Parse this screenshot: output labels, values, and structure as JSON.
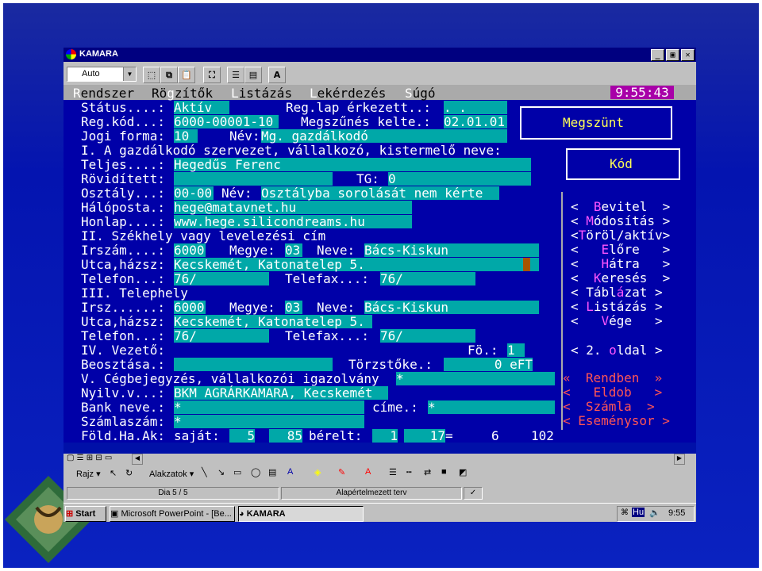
{
  "window": {
    "title": "KAMARA",
    "minimize": "_",
    "maximize": "▣",
    "close": "✕"
  },
  "toolbar": {
    "font_combo": "Auto",
    "font_button": "A"
  },
  "menu": {
    "items": [
      {
        "hotkey": "R",
        "rest": "endszer"
      },
      {
        "pre": "Rö",
        "hotkey": "g",
        "rest": "zítők"
      },
      {
        "hotkey": "L",
        "rest": "istázás"
      },
      {
        "hotkey": "L",
        "rest": "ekérdezés"
      },
      {
        "hotkey": "S",
        "rest": "úgó"
      }
    ],
    "clock": "9:55:43"
  },
  "form": {
    "status_label": "Státus....:",
    "status_value": "Aktív",
    "reg_lap_label": "Reg.lap érkezett..:",
    "reg_lap_value": ". .",
    "reg_kod_label": "Reg.kód...:",
    "reg_kod_value": "6000-00001-10",
    "megszunes_label": "Megszűnés kelte.:",
    "megszunes_value": "02.01.01",
    "jogi_label": "Jogi forma:",
    "jogi_value": "10",
    "jogi_nev_label": "Név:",
    "jogi_nev_value": "Mg. gazdálkodó",
    "section1": "I. A gazdálkodó szervezet, vállalkozó, kistermelő neve:",
    "teljes_label": "Teljes....:",
    "teljes_value": "Hegedűs Ferenc",
    "rovid_label": "Rövidített:",
    "tg_label": "TG:",
    "tg_value": "0",
    "osztaly_label": "Osztály...:",
    "osztaly_value": "00-00",
    "osztaly_nev_label": "Név:",
    "osztaly_nev_value": "Osztályba sorolását nem kérte",
    "haloposta_label": "Hálóposta.:",
    "haloposta_value": "hege@matavnet.hu",
    "honlap_label": "Honlap....:",
    "honlap_value": "www.hege.silicondreams.hu",
    "section2": "II. Székhely vagy levelezési cím",
    "irszam_label": "Irszám....:",
    "irszam_value": "6000",
    "megye_label": "Megye:",
    "megye_value": "03",
    "neve_label": "Neve:",
    "neve_value": "Bács-Kiskun",
    "utca_label": "Utca,házsz:",
    "utca_value": "Kecskemét, Katonatelep 5.",
    "telefon_label": "Telefon...:",
    "telefon_value": "76/",
    "telefax_label": "Telefax...:",
    "telefax_value": "76/",
    "section3": "III. Telephely",
    "irsz3_label": "Irsz......:",
    "irsz3_value": "6000",
    "megye3_label": "Megye:",
    "megye3_value": "03",
    "neve3_label": "Neve:",
    "neve3_value": "Bács-Kiskun",
    "utca3_label": "Utca,házsz:",
    "utca3_value": "Kecskemét, Katonatelep 5.",
    "telefon3_label": "Telefon...:",
    "telefon3_value": "76/",
    "telefax3_label": "Telefax...:",
    "telefax3_value": "76/",
    "section4": "IV. Vezető:",
    "fo_label": "Fö.:",
    "fo_value": "1",
    "beosztas_label": "Beosztása.:",
    "torzstoke_label": "Törzstőke.:",
    "torzstoke_value": "0",
    "torzstoke_unit": "eFT",
    "section5": "V. Cégbejegyzés, vállalkozói igazolvány",
    "section5_value": "*",
    "nyilv_label": "Nyilv.v...:",
    "nyilv_value": "BKM AGRÁRKAMARA, Kecskemét",
    "bank_label": "Bank neve.:",
    "bank_value": "*",
    "cime_label": "címe.:",
    "cime_value": "*",
    "szamla_label": "Számlaszám:",
    "szamla_value": "*",
    "fold_label": "Föld.Ha.Ak:",
    "sajat_label": "saját:",
    "sajat_value": "5",
    "sajat_ak": "85",
    "berelt_label": "bérelt:",
    "berelt_value": "1",
    "berelt_ak": "17",
    "eq": "=",
    "total_ha": "6",
    "total_ak": "102"
  },
  "sidebar": {
    "status_box": "Megszünt",
    "kod_box": "Kód",
    "buttons": [
      {
        "open": "<  ",
        "hotkey": "B",
        "rest": "evitel",
        "close": "  >"
      },
      {
        "open": "< ",
        "hotkey": "M",
        "rest": "ódosítás",
        "close": " >"
      },
      {
        "open": "<",
        "hotkey": "T",
        "rest": "öröl/aktív",
        "close": ">"
      },
      {
        "open": "<   ",
        "hotkey": "E",
        "rest": "lőre",
        "close": "   >"
      },
      {
        "open": "<   ",
        "hotkey": "H",
        "rest": "átra",
        "close": "   >"
      },
      {
        "open": "<  ",
        "hotkey": "K",
        "rest": "eresés",
        "close": "  >"
      },
      {
        "open": "< ",
        "pre": "Tábl",
        "hotkey": "á",
        "rest": "zat",
        "close": " >"
      },
      {
        "open": "< ",
        "hotkey": "L",
        "rest": "istázás",
        "close": " >"
      },
      {
        "open": "<   ",
        "hotkey": "V",
        "rest": "ége",
        "close": "   >"
      }
    ],
    "page_button": {
      "open": "< 2. ",
      "hotkey": "o",
      "rest": "ldal",
      "close": " >"
    },
    "bottom_buttons": [
      {
        "open": "«  ",
        "text": "Rendben",
        "close": "  »"
      },
      {
        "open": "<   ",
        "text": "Eldob",
        "close": "   >"
      },
      {
        "open": "<  ",
        "text": "Számla",
        "close": "  >"
      },
      {
        "open": "< ",
        "text": "Eseménysor",
        "close": " >"
      }
    ]
  },
  "drawing": {
    "draw_label": "Rajz",
    "shapes_label": "Alakzatok"
  },
  "statusbar": {
    "slide": "Dia 5 / 5",
    "design": "Alapértelmezett terv"
  },
  "taskbar": {
    "start": "Start",
    "task1": "Microsoft PowerPoint - [Be...",
    "task2": "KAMARA",
    "lang": "Hu",
    "time": "9:55"
  }
}
